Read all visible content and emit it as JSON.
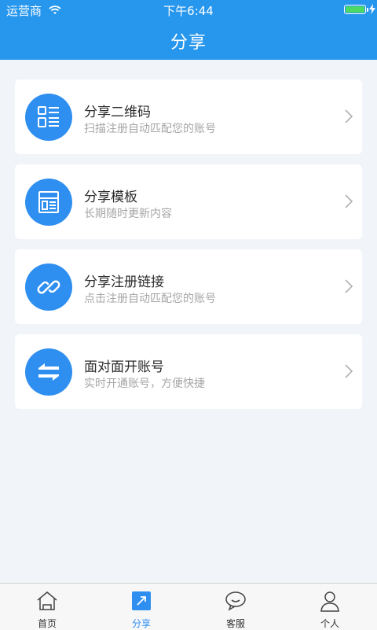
{
  "status_bar": {
    "carrier": "运营商",
    "time": "下午6:44"
  },
  "header": {
    "title": "分享"
  },
  "items": [
    {
      "icon": "qr-code-icon",
      "title": "分享二维码",
      "subtitle": "扫描注册自动匹配您的账号"
    },
    {
      "icon": "template-icon",
      "title": "分享模板",
      "subtitle": "长期随时更新内容"
    },
    {
      "icon": "link-icon",
      "title": "分享注册链接",
      "subtitle": "点击注册自动匹配您的账号"
    },
    {
      "icon": "exchange-icon",
      "title": "面对面开账号",
      "subtitle": "实时开通账号，方便快捷"
    }
  ],
  "tabs": [
    {
      "icon": "home-icon",
      "label": "首页",
      "active": false
    },
    {
      "icon": "share-icon",
      "label": "分享",
      "active": true
    },
    {
      "icon": "chat-bubble-icon",
      "label": "客服",
      "active": false
    },
    {
      "icon": "user-icon",
      "label": "个人",
      "active": false
    }
  ],
  "colors": {
    "primary": "#2797ee",
    "icon_circle": "#2f8ff0",
    "background": "#f1f4f8"
  }
}
